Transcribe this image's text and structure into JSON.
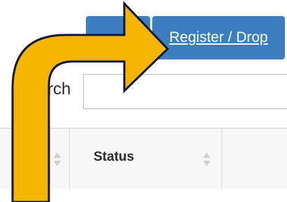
{
  "toolbar": {
    "register_drop_label": "Register / Drop"
  },
  "search": {
    "label": "rch",
    "value": ""
  },
  "table": {
    "columns": [
      "",
      "Status",
      ""
    ]
  },
  "colors": {
    "button_blue": "#3b7fc0",
    "arrow_fill": "#f7b500",
    "arrow_outline": "#0d1a3d"
  },
  "icons": [
    "sort-icon",
    "curved-arrow-icon"
  ]
}
